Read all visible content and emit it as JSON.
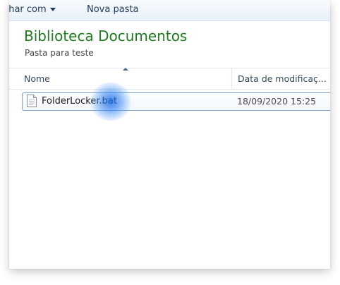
{
  "toolbar": {
    "share_label": "ilhar com",
    "new_folder_label": "Nova pasta"
  },
  "library": {
    "title": "Biblioteca Documentos",
    "subtitle": "Pasta para teste"
  },
  "columns": {
    "name": "Nome",
    "date_modified": "Data de modificaç..."
  },
  "files": [
    {
      "name": "FolderLocker.bat",
      "date": "18/09/2020 15:25",
      "icon": "document-icon"
    }
  ],
  "colors": {
    "title_green": "#1e7b1e",
    "selection_border": "#7da2ce",
    "toolbar_text": "#1e395b"
  }
}
